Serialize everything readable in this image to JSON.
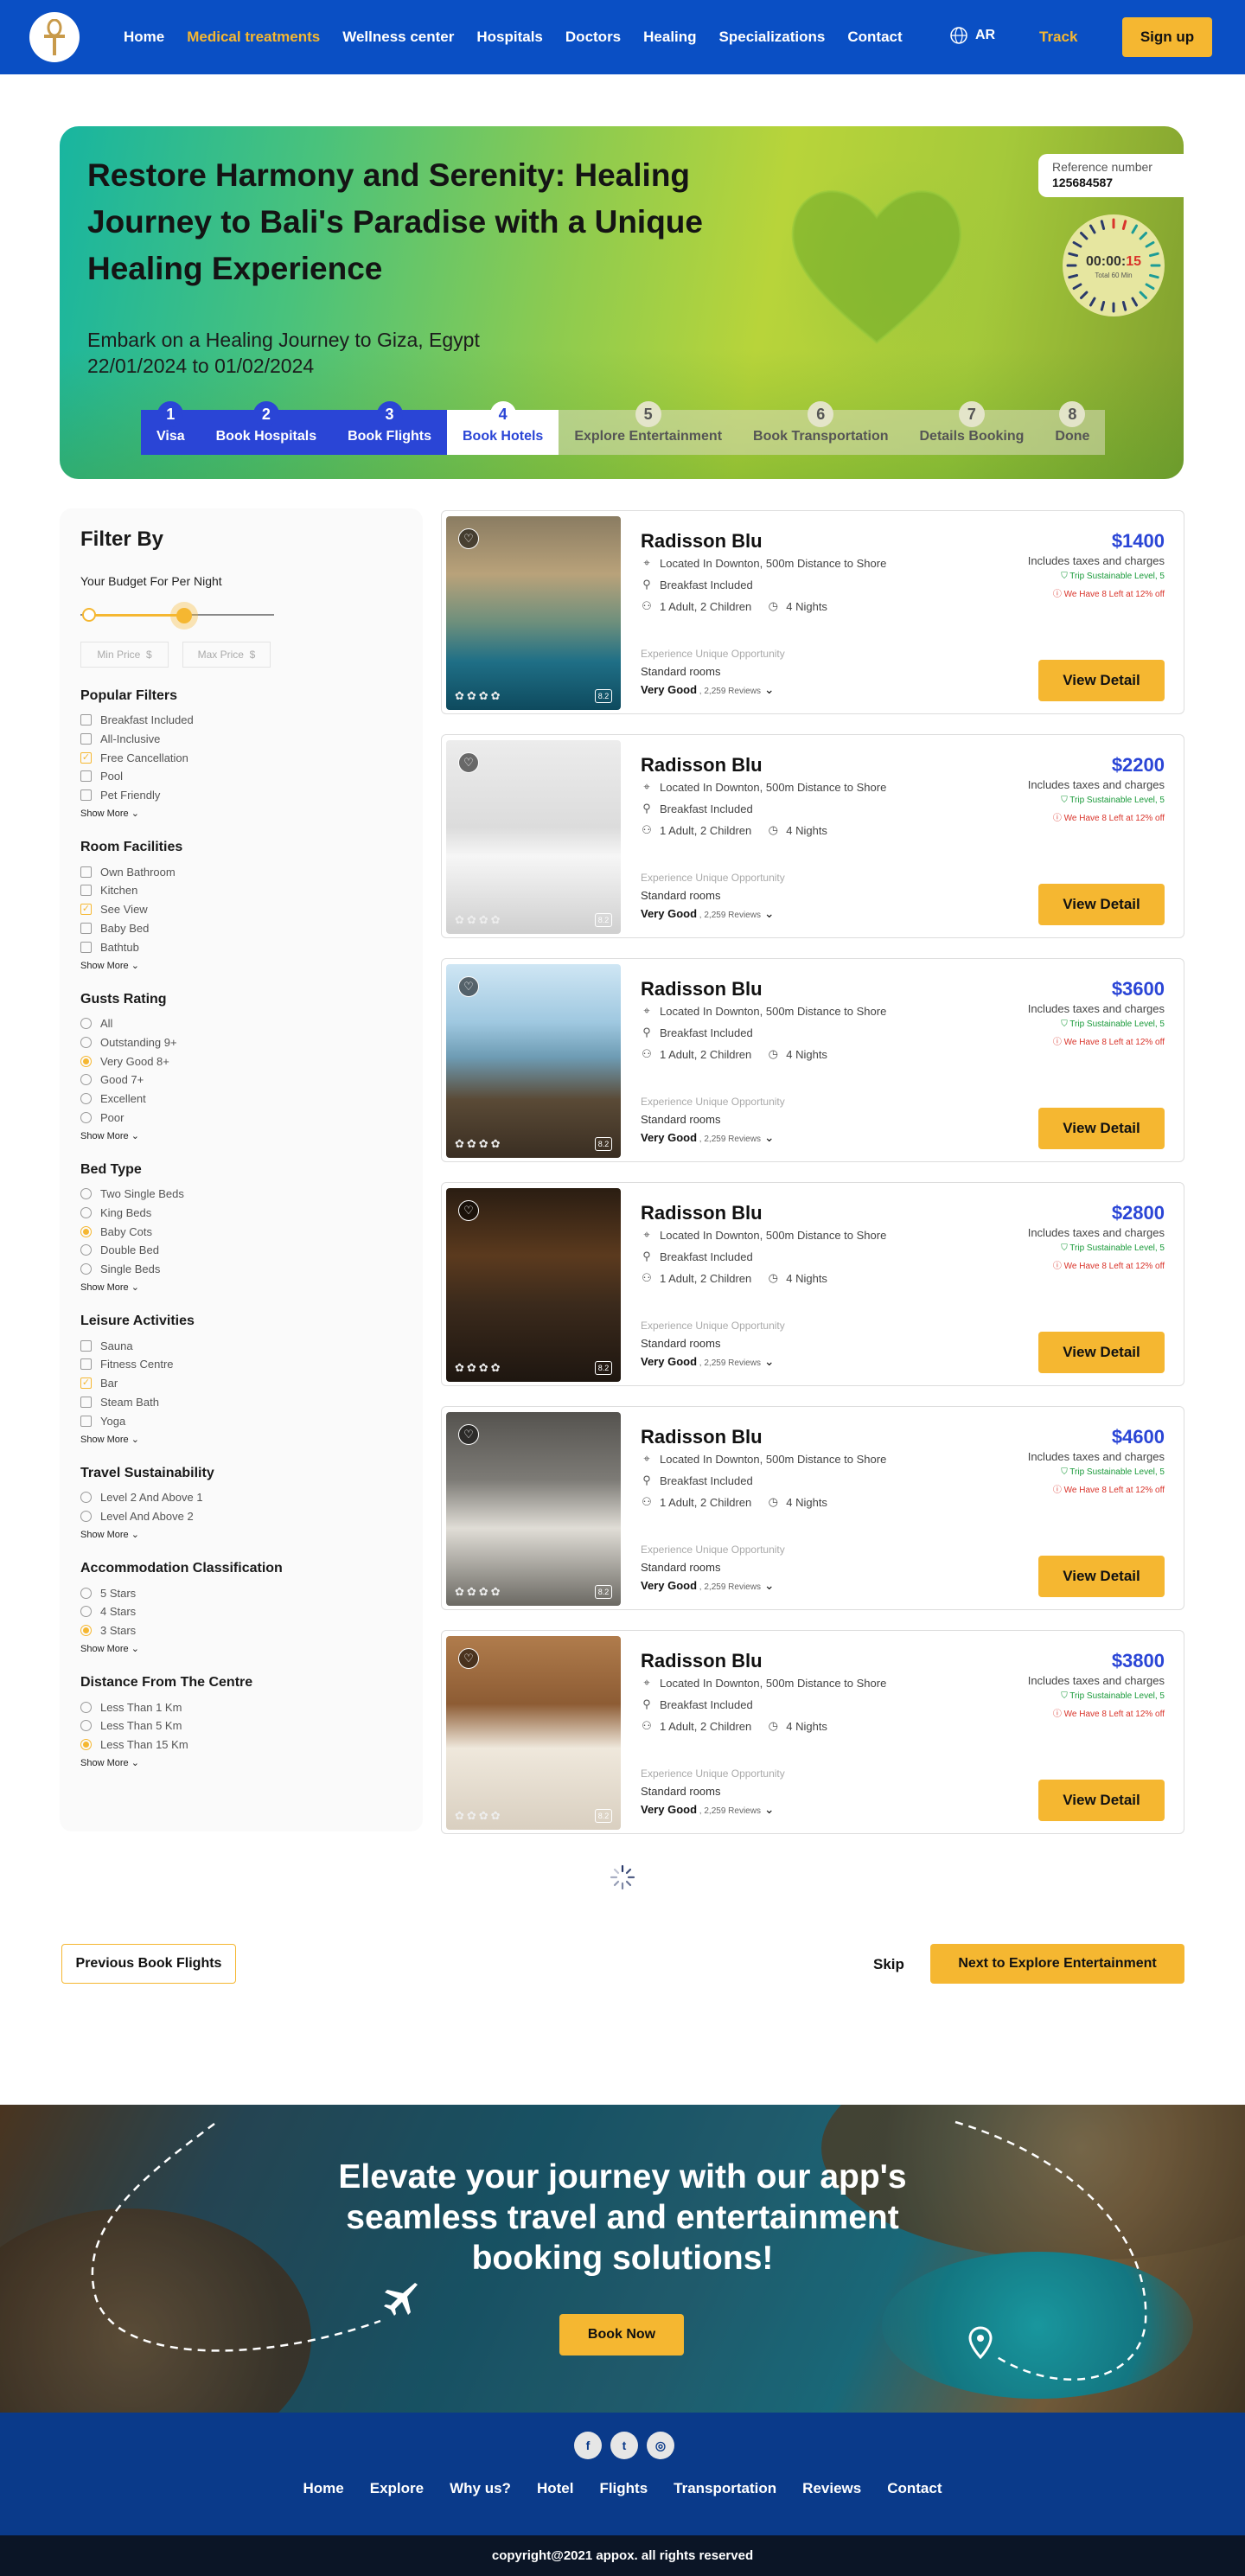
{
  "nav": {
    "links": [
      "Home",
      "Medical treatments",
      "Wellness center",
      "Hospitals",
      "Doctors",
      "Healing",
      "Specializations",
      "Contact"
    ],
    "active_index": 1,
    "lang": "AR",
    "track": "Track",
    "signup": "Sign up"
  },
  "hero": {
    "title": "Restore Harmony and Serenity: Healing Journey to Bali's Paradise with a Unique Healing Experience",
    "subtitle": "Embark on a Healing Journey to Giza, Egypt",
    "dates": "22/01/2024 to 01/02/2024",
    "ref_label": "Reference number",
    "ref_value": "125684587",
    "timer_main": "00:00:",
    "timer_red": "15",
    "timer_sub": "Total 60 Min",
    "steps": [
      {
        "n": "1",
        "label": "Visa",
        "state": "done"
      },
      {
        "n": "2",
        "label": "Book Hospitals",
        "state": "done"
      },
      {
        "n": "3",
        "label": "Book Flights",
        "state": "done"
      },
      {
        "n": "4",
        "label": "Book Hotels",
        "state": "current"
      },
      {
        "n": "5",
        "label": "Explore Entertainment",
        "state": "todo"
      },
      {
        "n": "6",
        "label": "Book Transportation",
        "state": "todo"
      },
      {
        "n": "7",
        "label": "Details Booking",
        "state": "todo"
      },
      {
        "n": "8",
        "label": "Done",
        "state": "todo"
      }
    ]
  },
  "filter": {
    "title": "Filter By",
    "budget_label": "Your Budget For Per Night",
    "min_price": "Min Price",
    "max_price": "Max Price",
    "currency_symbol": "$",
    "show_more": "Show More",
    "groups": [
      {
        "title": "Popular Filters",
        "type": "check",
        "items": [
          "Breakfast Included",
          "All-Inclusive",
          "Free Cancellation",
          "Pool",
          "Pet Friendly"
        ],
        "selected": [
          2
        ]
      },
      {
        "title": "Room Facilities",
        "type": "check",
        "items": [
          "Own Bathroom",
          "Kitchen",
          "See View",
          "Baby Bed",
          "Bathtub"
        ],
        "selected": [
          2
        ]
      },
      {
        "title": "Gusts Rating",
        "type": "radio",
        "items": [
          "All",
          "Outstanding 9+",
          "Very Good 8+",
          "Good 7+",
          "Excellent",
          "Poor"
        ],
        "selected": [
          2
        ]
      },
      {
        "title": "Bed Type",
        "type": "radio",
        "items": [
          "Two Single Beds",
          "King Beds",
          "Baby Cots",
          "Double Bed",
          "Single Beds"
        ],
        "selected": [
          2
        ]
      },
      {
        "title": "Leisure Activities",
        "type": "check",
        "items": [
          "Sauna",
          "Fitness Centre",
          "Bar",
          "Steam Bath",
          "Yoga"
        ],
        "selected": [
          2
        ]
      },
      {
        "title": "Travel Sustainability",
        "type": "radio",
        "items": [
          "Level 2 And Above 1",
          "Level And Above 2"
        ],
        "selected": []
      },
      {
        "title": "Accommodation Classification",
        "type": "radio",
        "items": [
          "5 Stars",
          "4 Stars",
          "3 Stars"
        ],
        "selected": [
          2
        ]
      },
      {
        "title": "Distance From The Centre",
        "type": "radio",
        "items": [
          "Less Than 1 Km",
          "Less Than 5 Km",
          "Less Than 15 Km"
        ],
        "selected": [
          2
        ]
      }
    ]
  },
  "hotels": [
    {
      "name": "Radisson Blu",
      "price": "$1400",
      "scene": "pool"
    },
    {
      "name": "Radisson Blu",
      "price": "$2200",
      "scene": "room-white"
    },
    {
      "name": "Radisson Blu",
      "price": "$3600",
      "scene": "terrace"
    },
    {
      "name": "Radisson Blu",
      "price": "$2800",
      "scene": "room-dark"
    },
    {
      "name": "Radisson Blu",
      "price": "$4600",
      "scene": "room-grey"
    },
    {
      "name": "Radisson Blu",
      "price": "$3800",
      "scene": "room-wood"
    }
  ],
  "hotel_common": {
    "location": "Located In Downton, 500m Distance to Shore",
    "breakfast": "Breakfast Included",
    "guests": "1 Adult,  2 Children",
    "nights": "4 Nights",
    "opportunity": "Experience Unique Opportunity",
    "room": "Standard rooms",
    "rating": "Very Good",
    "reviews": "2,259 Reviews",
    "score": "8.2",
    "tax": "Includes taxes and charges",
    "sustainable": "Trip Sustainable Level, 5",
    "left": "We Have 8 Left at 12% off",
    "view_btn": "View Detail"
  },
  "pager": {
    "prev": "Previous Book Flights",
    "skip": "Skip",
    "next": "Next to Explore Entertainment"
  },
  "banner": {
    "headline": "Elevate your journey with our app's seamless travel and entertainment booking solutions!",
    "button": "Book Now"
  },
  "footer": {
    "social": [
      "facebook-icon",
      "twitter-icon",
      "instagram-icon"
    ],
    "links": [
      "Home",
      "Explore",
      "Why us?",
      "Hotel",
      "Flights",
      "Transportation",
      "Reviews",
      "Contact"
    ],
    "copyright": "copyright@2021 appox. all rights reserved"
  },
  "colors": {
    "primary": "#0a4fc4",
    "accent": "#f5b731",
    "price": "#2a45d6",
    "footer": "#0a3a8a"
  }
}
